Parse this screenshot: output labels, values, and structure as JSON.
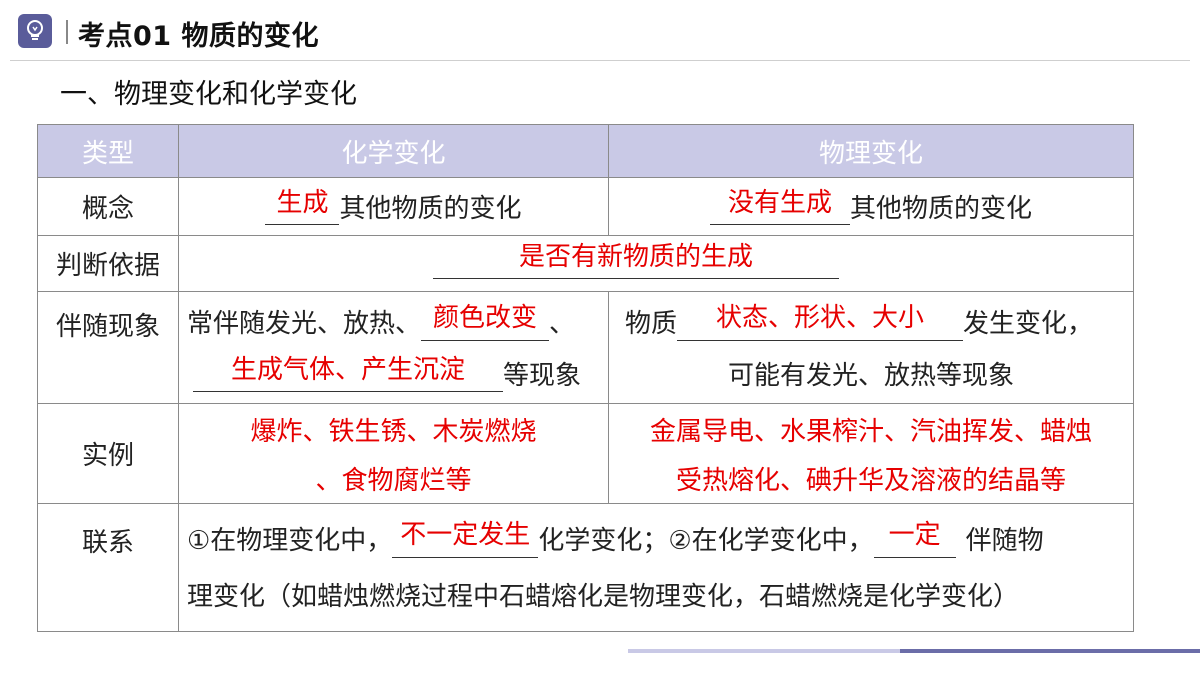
{
  "header": {
    "icon": "lightbulb-icon",
    "title": "考点01   物质的变化"
  },
  "subtitle": "一、物理变化和化学变化",
  "table": {
    "headers": [
      "类型",
      "化学变化",
      "物理变化"
    ],
    "concept": {
      "label": "概念",
      "chem_answer": "生成",
      "chem_text": "其他物质的变化",
      "phys_answer": "没有生成",
      "phys_text": "其他物质的变化"
    },
    "basis": {
      "label": "判断依据",
      "answer": "是否有新物质的生成"
    },
    "phenomena": {
      "label": "伴随现象",
      "chem_prefix": "常伴随发光、放热、",
      "chem_answer1": "颜色改变",
      "chem_sep": "、",
      "chem_answer2": "生成气体、产生沉淀",
      "chem_suffix": "等现象",
      "phys_prefix": "物质",
      "phys_answer": "状态、形状、大小",
      "phys_suffix": "发生变化，",
      "phys_line2": "可能有发光、放热等现象"
    },
    "examples": {
      "label": "实例",
      "chem_line1": "爆炸、铁生锈、木炭燃烧",
      "chem_line2": "、食物腐烂等",
      "phys_line1": "金属导电、水果榨汁、汽油挥发、蜡烛",
      "phys_line2": "受热熔化、碘升华及溶液的结晶等"
    },
    "relation": {
      "label": "联系",
      "part1": "①在物理变化中，",
      "answer1": "不一定发生",
      "part2": "化学变化；②在化学变化中，",
      "answer2": "一定",
      "part3": "伴随物",
      "line2": "理变化（如蜡烛燃烧过程中石蜡熔化是物理变化，石蜡燃烧是化学变化）"
    }
  },
  "colors": {
    "header_fill": "#c9c9e6",
    "answer_red": "#e60000",
    "logo_bg": "#5a5c9a"
  }
}
